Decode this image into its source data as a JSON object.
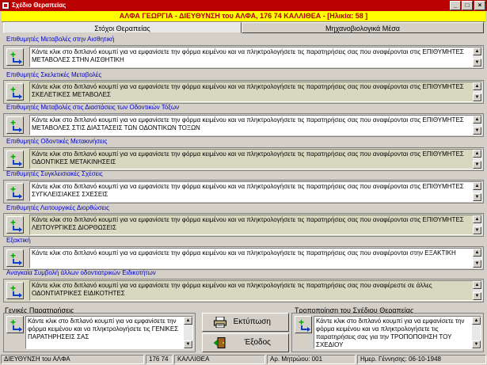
{
  "window": {
    "title": "Σχέδιο Θεραπείας",
    "btn_min": "_",
    "btn_max": "□",
    "btn_close": "×"
  },
  "banner": "ΑΛΦΑ ΓΕΩΡΓΙΑ - ΔΙΕΥΘΥΝΣΗ του ΑΛΦΑ, 176 74 ΚΑΛΛΙΘΕΑ - [Ηλικία: 58 ]",
  "tabs": {
    "active": "Στόχοι Θεραπείας",
    "inactive": "Μηχανοβιολογικά Μέσα"
  },
  "sections": [
    {
      "label": "Επιθυμητές Μεταβολές στην Αισθητική",
      "text": "Κάντε κλικ στο διπλανό κουμπί για να εμφανίσετε την φόρμα κειμένου και να πληκτρολογήσετε τις παρατηρήσεις σας που αναφέρονται στις ΕΠΙΘΥΜΗΤΕΣ ΜΕΤΑΒΟΛΕΣ ΣΤΗΝ ΑΙΣΘΗΤΙΚΗ"
    },
    {
      "label": "Επιθυμητές Σκελετικές Μεταβολές",
      "text": "Κάντε κλικ στο διπλανό κουμπί για να εμφανίσετε την φόρμα κειμένου και να πληκτρολογήσετε τις παρατηρήσεις σας που αναφέρονται στις ΕΠΙΘΥΜΗΤΕΣ ΣΚΕΛΕΤΙΚΕΣ ΜΕΤΑΒΟΛΕΣ"
    },
    {
      "label": "Επιθυμητές Μεταβολές στις Διαστάσεις των Οδοντικών Τόξων",
      "text": "Κάντε κλικ στο διπλανό κουμπί για να εμφανίσετε την φόρμα κειμένου και να πληκτρολογήσετε τις παρατηρήσεις σας που αναφέρονται στις ΕΠΙΘΥΜΗΤΕΣ ΜΕΤΑΒΟΛΕΣ ΣΤΙΣ ΔΙΑΣΤΑΣΕΙΣ ΤΩΝ ΟΔΟΝΤΙΚΩΝ ΤΟΞΩΝ"
    },
    {
      "label": "Επιθυμητές Οδοντικές Μετακινήσεις",
      "text": "Κάντε κλικ στο διπλανό κουμπί για να εμφανίσετε την φόρμα κειμένου και να πληκτρολογήσετε τις παρατηρήσεις σας που αναφέρονται στις ΕΠΙΘΥΜΗΤΕΣ ΟΔΟΝΤΙΚΕΣ ΜΕΤΑΚΙΝΗΣΕΙΣ"
    },
    {
      "label": "Επιθυμητές Συγκλεισιακές Σχέσεις",
      "text": "Κάντε κλικ στο διπλανό κουμπί για να εμφανίσετε την φόρμα κειμένου και να πληκτρολογήσετε τις παρατηρήσεις σας που αναφέρονται στις ΕΠΙΘΥΜΗΤΕΣ ΣΥΓΚΛΕΙΣΙΑΚΕΣ ΣΧΕΣΕΙΣ"
    },
    {
      "label": "Επιθυμητές Λειτουργικές Διορθώσεις",
      "text": "Κάντε κλικ στο διπλανό κουμπί για να εμφανίσετε την φόρμα κειμένου και να πληκτρολογήσετε τις παρατηρήσεις σας που αναφέρονται στις ΕΠΙΘΥΜΗΤΕΣ ΛΕΙΤΟΥΡΓΙΚΕΣ ΔΙΟΡΘΩΣΕΙΣ"
    },
    {
      "label": "Εξακτική",
      "text": "Κάντε κλικ στο διπλανό κουμπί για να εμφανίσετε την φόρμα κειμένου και να πληκτρολογήσετε τις παρατηρήσεις σας που αναφέρονται στην ΕΞΑΚΤΙΚΗ"
    },
    {
      "label": "Αναγκαία Συμβολή άλλων οδοντιατρικών Ειδικοτήτων",
      "text": "Κάντε κλικ στο διπλανό κουμπί για να εμφανίσετε την φόρμα κειμένου και να πληκτρολογήσετε τις παρατηρήσεις σας που αναφέρεστε σε άλλες ΟΔΟΝΤΙΑΤΡΙΚΕΣ ΕΙΔΙΚΟΤΗΤΕΣ"
    }
  ],
  "general_notes": {
    "label": "Γενικές Παρατηρήσεις",
    "text": "Κάντε κλικ στο διπλανό κουμπί για να εμφανίσετε την φόρμα κειμένου και να πληκτρολογήσετε τις ΓΕΝΙΚΕΣ ΠΑΡΑΤΗΡΗΣΕΙΣ ΣΑΣ"
  },
  "modification": {
    "label": "Τροποποίηση του Σχέδιου Θεραπείας",
    "text": "Κάντε κλικ στο διπλανό κουμπί για να εμφανίσετε την φόρμα κειμένου και να πληκτρολογήσετε τις παρατηρήσεις σας για την ΤΡΟΠΟΠΟΙΗΣΗ ΤΟΥ ΣΧΕΔΙΟΥ"
  },
  "buttons": {
    "print": "Εκτύπωση",
    "exit": "Έξοδος"
  },
  "icons": {
    "add": "add-note-icon",
    "print": "printer-icon",
    "exit": "door-exit-icon"
  },
  "status": {
    "address": "ΔΙΕΥΘΥΝΣΗ του ΑΛΦΑ",
    "zip": "176 74",
    "city": "ΚΑΛΛΙΘΕΑ",
    "record": "Αρ. Μητρώου: 001",
    "birthdate": "Ημερ. Γέννησης: 06-10-1948"
  },
  "colors": {
    "titlebar": "#bb0000",
    "banner_bg": "#ffff00",
    "banner_fg": "#b00000",
    "section_label": "#0000cc"
  }
}
